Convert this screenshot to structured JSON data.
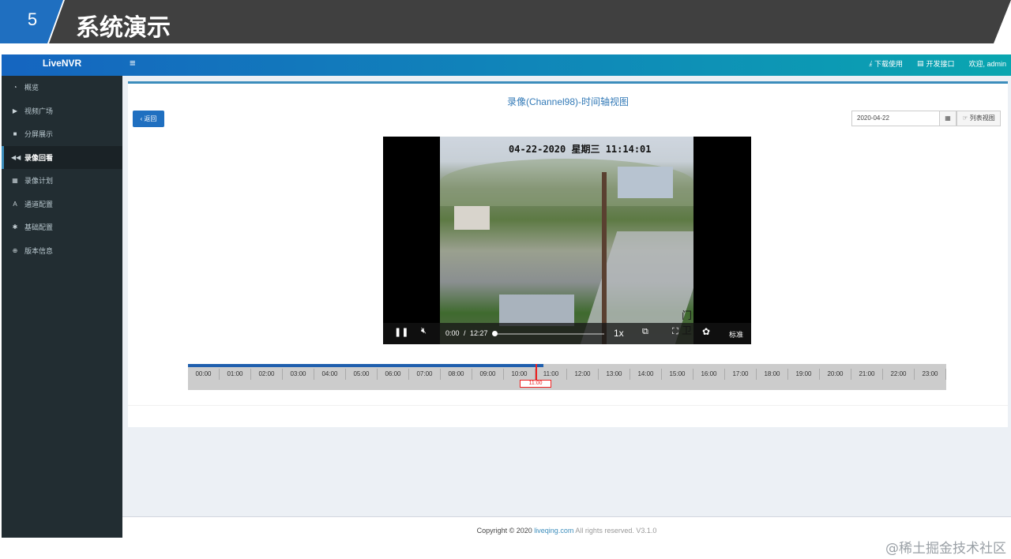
{
  "slide": {
    "number": "5",
    "title": "系统演示"
  },
  "app": {
    "brand": "LiveNVR",
    "hamburger": "≡",
    "topnav": [
      {
        "icon": "download-icon",
        "glyph": "⤓",
        "label": "下载使用"
      },
      {
        "icon": "book-icon",
        "glyph": "▤",
        "label": "开发接口"
      },
      {
        "icon": "",
        "glyph": "",
        "label": "欢迎, admin"
      }
    ]
  },
  "sidebar": {
    "items": [
      {
        "icon": "dashboard-icon",
        "glyph": "◔",
        "label": "概览"
      },
      {
        "icon": "play-icon",
        "glyph": "▶",
        "label": "视频广场"
      },
      {
        "icon": "grid-icon",
        "glyph": "■",
        "label": "分屏展示"
      },
      {
        "icon": "rewind-icon",
        "glyph": "◀◀",
        "label": "录像回看"
      },
      {
        "icon": "calendar-icon",
        "glyph": "▦",
        "label": "录像计划"
      },
      {
        "icon": "road-icon",
        "glyph": "A",
        "label": "通道配置"
      },
      {
        "icon": "gear-icon",
        "glyph": "✱",
        "label": "基础配置"
      },
      {
        "icon": "info-icon",
        "glyph": "⊕",
        "label": "版本信息"
      }
    ],
    "active_index": 3
  },
  "content": {
    "title": "录像(Channel98)-时间轴视图",
    "back_label": "返回",
    "date_value": "2020-04-22",
    "list_view_label": "列表视图"
  },
  "player": {
    "timestamp": "04-22-2020 星期三 11:14:01",
    "overlay_text": "门卫",
    "time_current": "0:00",
    "time_sep": "/",
    "time_total": "12:27",
    "speed": "1x",
    "quality": "标准"
  },
  "timeline": {
    "hours": [
      "00:00",
      "01:00",
      "02:00",
      "03:00",
      "04:00",
      "05:00",
      "06:00",
      "07:00",
      "08:00",
      "09:00",
      "10:00",
      "11:00",
      "12:00",
      "13:00",
      "14:00",
      "15:00",
      "16:00",
      "17:00",
      "18:00",
      "19:00",
      "20:00",
      "21:00",
      "22:00",
      "23:00"
    ],
    "cursor_label": "11:00",
    "recorded_until_fraction": 0.469
  },
  "footer": {
    "prefix": "Copyright © 2020 ",
    "link": "liveqing.com",
    "suffix": " All rights reserved. V3.1.0"
  },
  "watermark": "@稀土掘金技术社区"
}
